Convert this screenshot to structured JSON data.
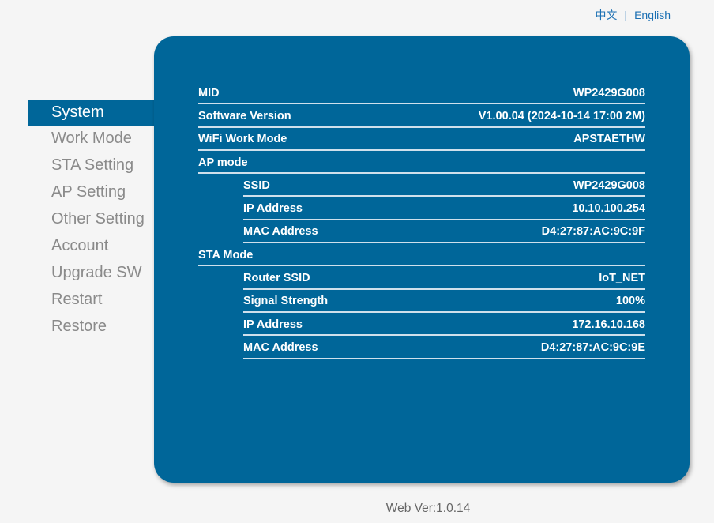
{
  "lang": {
    "zh": "中文",
    "sep": "|",
    "en": "English"
  },
  "sidebar": {
    "items": [
      {
        "label": "System",
        "active": true
      },
      {
        "label": "Work Mode"
      },
      {
        "label": "STA Setting"
      },
      {
        "label": "AP Setting"
      },
      {
        "label": "Other Setting"
      },
      {
        "label": "Account"
      },
      {
        "label": "Upgrade SW"
      },
      {
        "label": "Restart"
      },
      {
        "label": "Restore"
      }
    ]
  },
  "rows": [
    {
      "label": "MID",
      "value": "WP2429G008"
    },
    {
      "label": "Software Version",
      "value": "V1.00.04 (2024-10-14 17:00 2M)"
    },
    {
      "label": "WiFi Work Mode",
      "value": "APSTAETHW"
    },
    {
      "label": "AP mode",
      "value": ""
    },
    {
      "label": "SSID",
      "value": "WP2429G008"
    },
    {
      "label": "IP Address",
      "value": "10.10.100.254"
    },
    {
      "label": "MAC Address",
      "value": "D4:27:87:AC:9C:9F"
    },
    {
      "label": "STA Mode",
      "value": ""
    },
    {
      "label": "Router SSID",
      "value": "IoT_NET"
    },
    {
      "label": "Signal Strength",
      "value": "100%"
    },
    {
      "label": "IP Address",
      "value": "172.16.10.168"
    },
    {
      "label": "MAC Address",
      "value": "D4:27:87:AC:9C:9E"
    }
  ],
  "footer": "Web Ver:1.0.14"
}
